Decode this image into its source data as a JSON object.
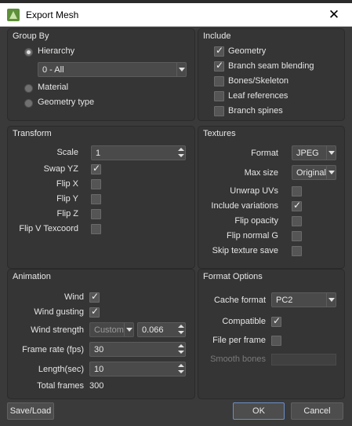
{
  "window": {
    "title": "Export Mesh"
  },
  "group_by": {
    "title": "Group By",
    "options": [
      "Hierarchy",
      "Material",
      "Geometry type"
    ],
    "hierarchy_select": "0 - All"
  },
  "include": {
    "title": "Include",
    "items": [
      {
        "label": "Geometry",
        "checked": true
      },
      {
        "label": "Branch seam blending",
        "checked": true
      },
      {
        "label": "Bones/Skeleton",
        "checked": false
      },
      {
        "label": "Leaf references",
        "checked": false
      },
      {
        "label": "Branch spines",
        "checked": false
      }
    ]
  },
  "transform": {
    "title": "Transform",
    "scale_label": "Scale",
    "scale_value": "1",
    "flags": [
      {
        "label": "Swap YZ",
        "checked": true
      },
      {
        "label": "Flip X",
        "checked": false
      },
      {
        "label": "Flip Y",
        "checked": false
      },
      {
        "label": "Flip Z",
        "checked": false
      },
      {
        "label": "Flip V Texcoord",
        "checked": false
      }
    ]
  },
  "textures": {
    "title": "Textures",
    "format_label": "Format",
    "format_value": "JPEG",
    "maxsize_label": "Max size",
    "maxsize_value": "Original",
    "flags": [
      {
        "label": "Unwrap UVs",
        "checked": false
      },
      {
        "label": "Include variations",
        "checked": true
      },
      {
        "label": "Flip opacity",
        "checked": false
      },
      {
        "label": "Flip normal G",
        "checked": false
      },
      {
        "label": "Skip texture save",
        "checked": false
      }
    ]
  },
  "animation": {
    "title": "Animation",
    "wind_label": "Wind",
    "wind_checked": true,
    "gusting_label": "Wind gusting",
    "gusting_checked": true,
    "strength_label": "Wind strength",
    "strength_mode": "Custom",
    "strength_value": "0.066",
    "framerate_label": "Frame rate (fps)",
    "framerate_value": "30",
    "length_label": "Length(sec)",
    "length_value": "10",
    "total_label": "Total frames",
    "total_value": "300"
  },
  "format_options": {
    "title": "Format Options",
    "cache_label": "Cache format",
    "cache_value": "PC2",
    "compatible_label": "Compatible",
    "compatible_checked": true,
    "perframe_label": "File per frame",
    "perframe_checked": false,
    "smooth_label": "Smooth bones",
    "smooth_checked": false
  },
  "buttons": {
    "save_load": "Save/Load",
    "ok": "OK",
    "cancel": "Cancel"
  }
}
